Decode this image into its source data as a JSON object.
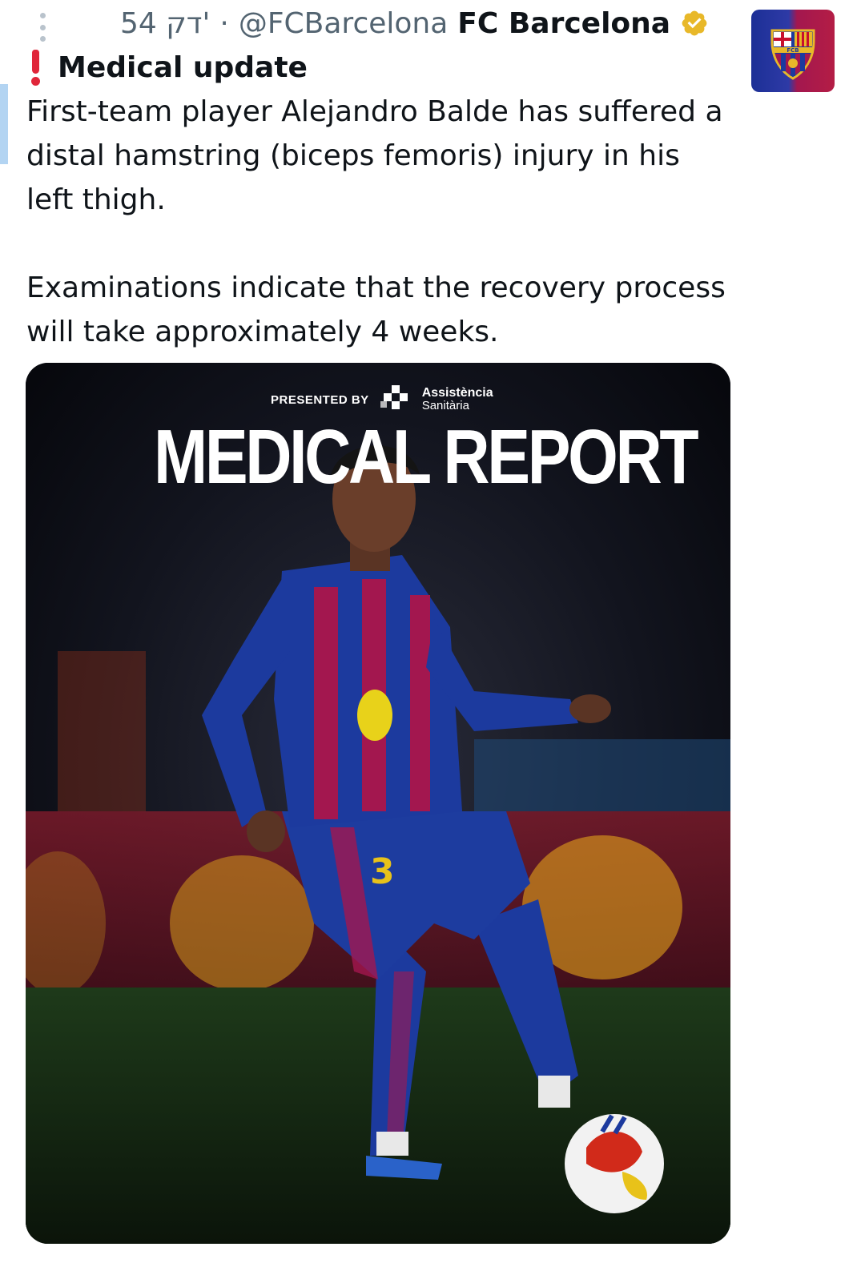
{
  "tweet": {
    "time": "54 דק'",
    "handle": "@FCBarcelona",
    "author_name": "FC Barcelona",
    "title": "Medical update",
    "paragraphs": [
      "First-team player Alejandro Balde has suffered a distal hamstring (biceps femoris) injury in his left thigh.",
      "Examinations indicate that the recovery process will take approximately 4 weeks."
    ]
  },
  "media": {
    "presented_by": "PRESENTED BY",
    "sponsor_line1": "Assistència",
    "sponsor_line2": "Sanitària",
    "headline": "MEDICAL REPORT",
    "shirt_number": "3"
  },
  "icons": {
    "more": "more-vertical-icon",
    "verified": "verified-badge-icon",
    "exclamation": "red-exclamation-icon",
    "avatar": "fc-barcelona-crest-icon"
  },
  "colors": {
    "text": "#0f1419",
    "meta": "#536471",
    "verified": "#e8b829",
    "barca_blue": "#1c3a9e",
    "barca_red": "#a3174f",
    "accent_bar": "#b3d4f2"
  }
}
